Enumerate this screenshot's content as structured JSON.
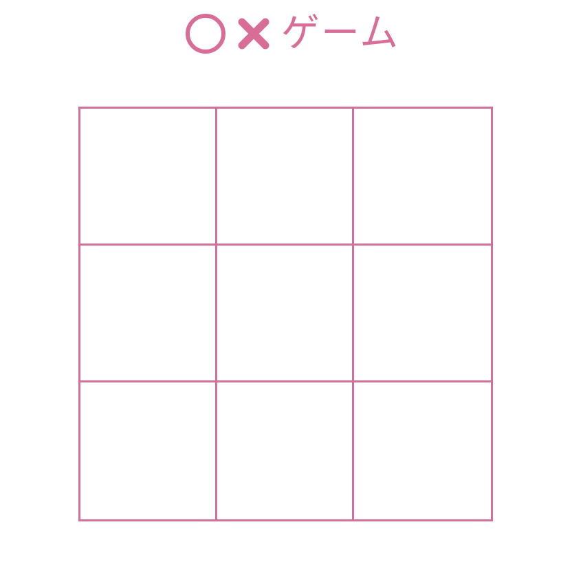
{
  "header": {
    "circle_icon": "circle-mark-icon",
    "cross_icon": "cross-mark-icon",
    "title_text": "ゲーム"
  },
  "theme": {
    "accent": "#d86e98",
    "grid_line": "#d46f9a",
    "background": "#ffffff"
  },
  "board": {
    "rows": 3,
    "cols": 3,
    "cells": [
      [
        "",
        "",
        ""
      ],
      [
        "",
        "",
        ""
      ],
      [
        "",
        "",
        ""
      ]
    ]
  }
}
